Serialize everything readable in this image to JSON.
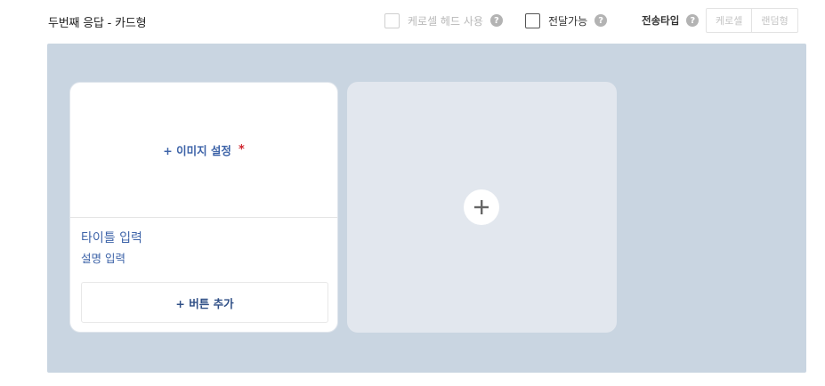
{
  "header": {
    "title": "두번째 응답 - 카드형",
    "carousel_head_label": "케로셀 헤드 사용",
    "deliverable_label": "전달가능",
    "send_type_label": "전송타입",
    "send_type_options": [
      "케로셀",
      "랜덤형"
    ],
    "help_glyph": "?"
  },
  "card": {
    "image_set_label": "+ 이미지 설정",
    "required_mark": "*",
    "title_placeholder": "타이틀 입력",
    "desc_placeholder": "설명 입력",
    "add_button_label": "+ 버튼 추가"
  },
  "add_card": {
    "icon": "plus-icon"
  },
  "colors": {
    "canvas_bg": "#c9d5e1",
    "accent_text": "#3d63a8",
    "required": "#d0262f"
  }
}
